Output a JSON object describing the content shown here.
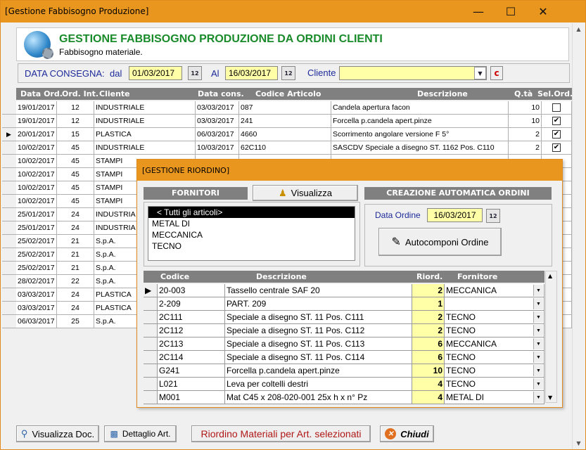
{
  "window": {
    "title": "[Gestione Fabbisogno Produzione]"
  },
  "header": {
    "title": "GESTIONE FABBISOGNO PRODUZIONE DA ORDINI CLIENTI",
    "subtitle": "Fabbisogno materiale."
  },
  "filter": {
    "date_label": "DATA CONSEGNA:",
    "from_label": "dal",
    "from_value": "01/03/2017",
    "to_label": "Al",
    "to_value": "16/03/2017",
    "client_label": "Cliente",
    "client_value": "",
    "clear_label": "c"
  },
  "grid": {
    "columns": [
      "Data Ord.",
      "Ord. Int.",
      "Cliente",
      "Data cons.",
      "Codice Articolo",
      "Descrizione",
      "Q.tà",
      "Sel.Ord."
    ],
    "rows": [
      {
        "data_ord": "19/01/2017",
        "ord_int": "12",
        "cliente": "INDUSTRIALE",
        "data_cons": "03/03/2017",
        "codice": "087",
        "descrizione": "Candela apertura facon",
        "qta": "10",
        "sel": ""
      },
      {
        "data_ord": "19/01/2017",
        "ord_int": "12",
        "cliente": "INDUSTRIALE",
        "data_cons": "03/03/2017",
        "codice": "241",
        "descrizione": "Forcella p.candela apert.pinze",
        "qta": "10",
        "sel": "✔"
      },
      {
        "data_ord": "20/01/2017",
        "ord_int": "15",
        "cliente": "PLASTICA",
        "data_cons": "06/03/2017",
        "codice": "4660",
        "descrizione": "Scorrimento angolare versione F 5°",
        "qta": "2",
        "sel": "✔"
      },
      {
        "data_ord": "10/02/2017",
        "ord_int": "45",
        "cliente": "INDUSTRIALE",
        "data_cons": "10/03/2017",
        "codice": "62C110",
        "descrizione": "SASCDV Speciale a disegno ST. 1162 Pos. C110",
        "qta": "2",
        "sel": "✔"
      },
      {
        "data_ord": "10/02/2017",
        "ord_int": "45",
        "cliente": "STAMPI"
      },
      {
        "data_ord": "10/02/2017",
        "ord_int": "45",
        "cliente": "STAMPI"
      },
      {
        "data_ord": "10/02/2017",
        "ord_int": "45",
        "cliente": "STAMPI"
      },
      {
        "data_ord": "10/02/2017",
        "ord_int": "45",
        "cliente": "STAMPI"
      },
      {
        "data_ord": "25/01/2017",
        "ord_int": "24",
        "cliente": "INDUSTRIA"
      },
      {
        "data_ord": "25/01/2017",
        "ord_int": "24",
        "cliente": "INDUSTRIA"
      },
      {
        "data_ord": "25/02/2017",
        "ord_int": "21",
        "cliente": "S.p.A."
      },
      {
        "data_ord": "25/02/2017",
        "ord_int": "21",
        "cliente": "S.p.A."
      },
      {
        "data_ord": "25/02/2017",
        "ord_int": "21",
        "cliente": "S.p.A."
      },
      {
        "data_ord": "28/02/2017",
        "ord_int": "22",
        "cliente": "S.p.A."
      },
      {
        "data_ord": "03/03/2017",
        "ord_int": "24",
        "cliente": "PLASTICA"
      },
      {
        "data_ord": "03/03/2017",
        "ord_int": "24",
        "cliente": "PLASTICA"
      },
      {
        "data_ord": "06/03/2017",
        "ord_int": "25",
        "cliente": "S.p.A."
      }
    ]
  },
  "popup": {
    "title": "[GESTIONE RIORDINO]",
    "fornitori_label": "FORNITORI",
    "visualizza_label": "Visualizza",
    "creazione_label": "CREAZIONE AUTOMATICA ORDINI",
    "fornitori": [
      "< Tutti gli articoli>",
      "METAL DI",
      "MECCANICA",
      "TECNO"
    ],
    "data_ordine_label": "Data Ordine",
    "data_ordine_value": "16/03/2017",
    "autocomponi_label": "Autocomponi Ordine",
    "columns": [
      "Codice",
      "Descrizione",
      "Riord.",
      "Fornitore"
    ],
    "rows": [
      {
        "codice": "20-003",
        "descrizione": "Tassello centrale SAF 20",
        "riord": "2",
        "fornitore": "MECCANICA"
      },
      {
        "codice": "2-209",
        "descrizione": "PART. 209",
        "riord": "1",
        "fornitore": ""
      },
      {
        "codice": "2C111",
        "descrizione": "Speciale a disegno ST. 11 Pos. C111",
        "riord": "2",
        "fornitore": "TECNO"
      },
      {
        "codice": "2C112",
        "descrizione": "Speciale a disegno ST. 11 Pos. C112",
        "riord": "2",
        "fornitore": "TECNO"
      },
      {
        "codice": "2C113",
        "descrizione": "Speciale a disegno ST. 11 Pos. C113",
        "riord": "6",
        "fornitore": "MECCANICA"
      },
      {
        "codice": "2C114",
        "descrizione": "Speciale a disegno ST. 11 Pos. C114",
        "riord": "6",
        "fornitore": "TECNO"
      },
      {
        "codice": "G241",
        "descrizione": "Forcella p.candela apert.pinze",
        "riord": "10",
        "fornitore": "TECNO"
      },
      {
        "codice": "L021",
        "descrizione": "Leva per coltelli destri",
        "riord": "4",
        "fornitore": "TECNO"
      },
      {
        "codice": "M001",
        "descrizione": "Mat C45 x 208-020-001 25x h x n° Pz",
        "riord": "4",
        "fornitore": "METAL DI"
      }
    ]
  },
  "footer": {
    "visualizza_doc": "Visualizza Doc.",
    "dettaglio_art": "Dettaglio Art.",
    "riordino": "Riordino Materiali per Art. selezionati",
    "chiudi": "Chiudi"
  },
  "colors": {
    "title_bar": "#e9961f",
    "header_title": "#1a8b2a",
    "label_blue": "#1d2a9a",
    "field_yellow": "#ffffa8",
    "grid_header": "#808080",
    "riordino_text": "#b01818"
  }
}
